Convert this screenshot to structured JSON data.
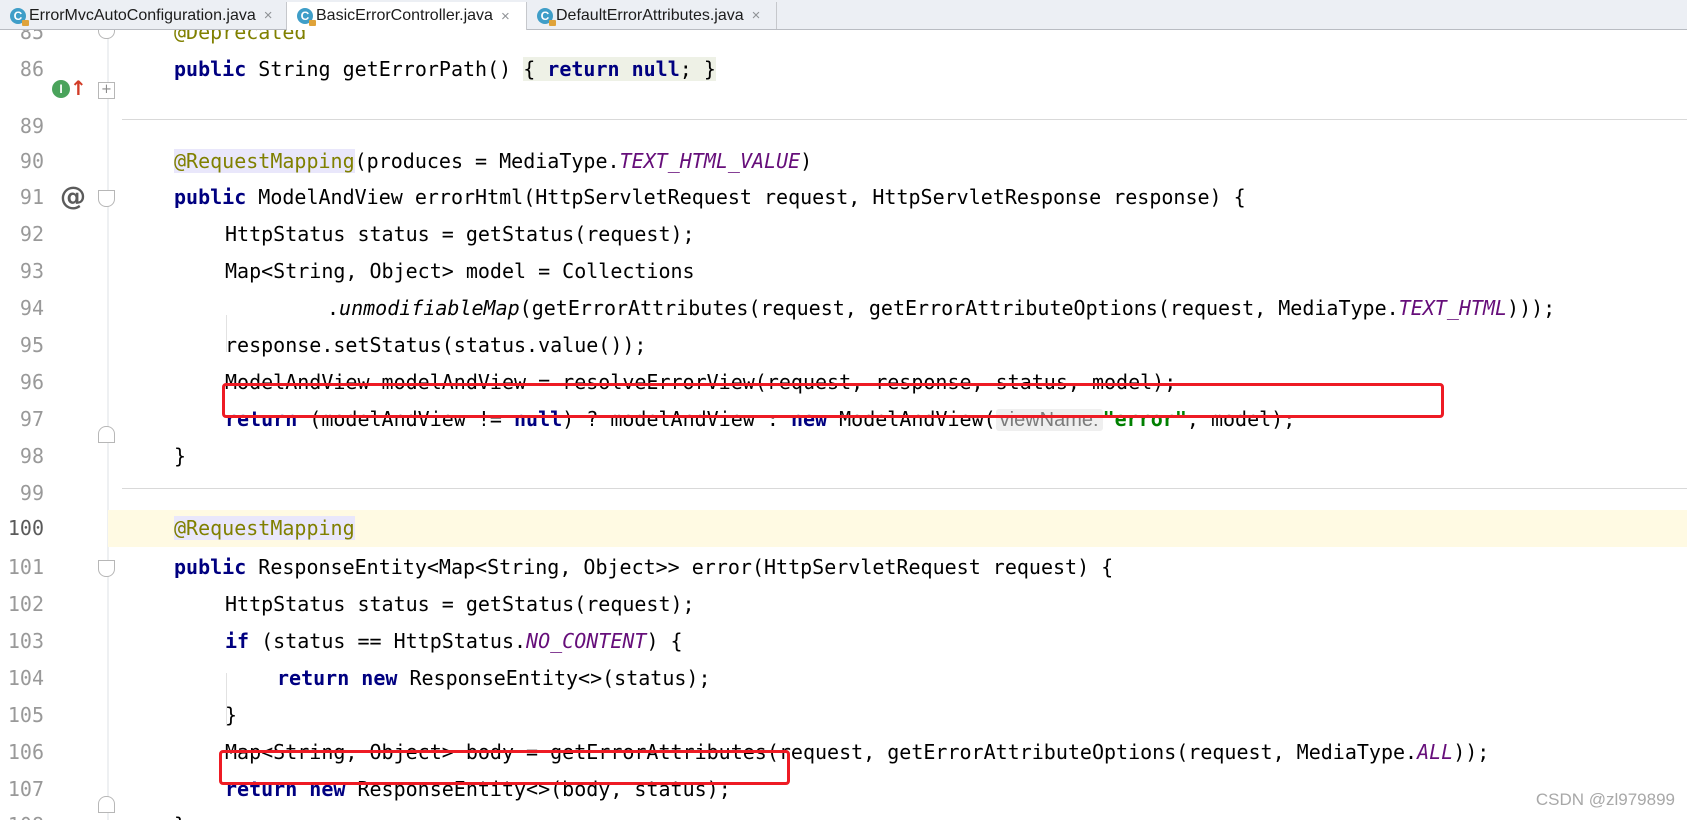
{
  "tabs": [
    {
      "label": "ErrorMvcAutoConfiguration.java",
      "icon": "C",
      "active": false
    },
    {
      "label": "BasicErrorController.java",
      "icon": "C",
      "active": true
    },
    {
      "label": "DefaultErrorAttributes.java",
      "icon": "C",
      "active": false
    }
  ],
  "tab_close_glyph": "×",
  "gutter_icons": {
    "implements_marker": "I",
    "override_arrow": "↑",
    "mapping_marker": "@"
  },
  "fold_glyph_expand": "+",
  "fold_glyph_collapse": "−",
  "lines": {
    "l85": {
      "num": "85",
      "a": "@Deprecated"
    },
    "l86": {
      "num": "86",
      "a": "public",
      "b": " String getErrorPath() ",
      "c": "{ ",
      "d": "return",
      "e": " ",
      "f": "null",
      "g": "; }"
    },
    "l89": {
      "num": "89"
    },
    "l90": {
      "num": "90",
      "a": "@RequestMapping",
      "b": "(produces = MediaType.",
      "c": "TEXT_HTML_VALUE",
      "d": ")"
    },
    "l91": {
      "num": "91",
      "a": "public",
      "b": " ModelAndView errorHtml(HttpServletRequest request, HttpServletResponse response) {"
    },
    "l92": {
      "num": "92",
      "a": "HttpStatus status = getStatus(request);"
    },
    "l93": {
      "num": "93",
      "a": "Map<String, Object> model = Collections"
    },
    "l94": {
      "num": "94",
      "a": ".",
      "b": "unmodifiableMap",
      "c": "(getErrorAttributes(request, getErrorAttributeOptions(request, MediaType.",
      "d": "TEXT_HTML",
      "e": ")));"
    },
    "l95": {
      "num": "95",
      "a": "response.setStatus(status.value());"
    },
    "l96": {
      "num": "96",
      "a": "ModelAndView modelAndView = resolveErrorView(request, response, status, model);"
    },
    "l97": {
      "num": "97",
      "a": "return",
      "b": " (modelAndView != ",
      "c": "null",
      "d": ") ? modelAndView : ",
      "e": "new",
      "f": " ModelAndView(",
      "hint": "viewName:",
      "g": "\"error\"",
      "h": ", model);"
    },
    "l98": {
      "num": "98",
      "a": "}"
    },
    "l99": {
      "num": "99"
    },
    "l100": {
      "num": "100",
      "a": "@RequestMapping"
    },
    "l101": {
      "num": "101",
      "a": "public",
      "b": " ResponseEntity<Map<String, Object>> error(HttpServletRequest request) {"
    },
    "l102": {
      "num": "102",
      "a": "HttpStatus status = getStatus(request);"
    },
    "l103": {
      "num": "103",
      "a": "if",
      "b": " (status == HttpStatus.",
      "c": "NO_CONTENT",
      "d": ") {"
    },
    "l104": {
      "num": "104",
      "a": "return",
      "b": " ",
      "c": "new",
      "d": " ResponseEntity<>(status);"
    },
    "l105": {
      "num": "105",
      "a": "}"
    },
    "l106": {
      "num": "106",
      "a": "Map<String, Object> body = getErrorAttributes(request, getErrorAttributeOptions(request, MediaType.",
      "b": "ALL",
      "c": "));"
    },
    "l107": {
      "num": "107",
      "a": "return",
      "b": " ",
      "c": "new",
      "d": " ResponseEntity<>(body, status);"
    },
    "l108": {
      "num": "108",
      "a": "}"
    }
  },
  "colors": {
    "keyword": "#000080",
    "annotation": "#808000",
    "static_field": "#660e7a",
    "string": "#008000",
    "highlight_box": "#ee1b24",
    "caret_line": "#fffae3"
  },
  "watermark": "CSDN @zl979899"
}
